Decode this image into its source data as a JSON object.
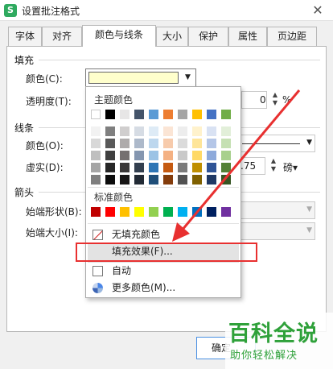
{
  "window": {
    "title": "设置批注格式",
    "app_logo": "S",
    "close": "✕"
  },
  "tabs": [
    {
      "label": "字体"
    },
    {
      "label": "对齐"
    },
    {
      "label": "颜色与线条"
    },
    {
      "label": "大小"
    },
    {
      "label": "保护"
    },
    {
      "label": "属性"
    },
    {
      "label": "页边距"
    }
  ],
  "fill": {
    "section": "填充",
    "color_label": "颜色(C):",
    "color_value": "#ffffcc",
    "transparency_label": "透明度(T):",
    "transparency_value": "0",
    "transparency_unit": "%"
  },
  "line": {
    "section": "线条",
    "color_label": "颜色(O):",
    "dash_label": "虚实(D):",
    "weight_value": ".75",
    "weight_unit": "磅▾"
  },
  "arrows": {
    "section": "箭头",
    "begin_style_label": "始端形状(B):",
    "begin_size_label": "始端大小(I):"
  },
  "color_popup": {
    "theme_heading": "主题颜色",
    "standard_heading": "标准颜色",
    "theme_top_row": [
      "#ffffff",
      "#000000",
      "#e7e6e6",
      "#44546a",
      "#5b9bd5",
      "#ed7d31",
      "#a5a5a5",
      "#ffc000",
      "#4472c4",
      "#70ad47"
    ],
    "theme_shades": [
      [
        "#f2f2f2",
        "#7f7f7f",
        "#d0cece",
        "#d6dce4",
        "#deebf6",
        "#fbe5d5",
        "#ededed",
        "#fff2cc",
        "#d9e2f3",
        "#e2efd9"
      ],
      [
        "#d8d8d8",
        "#595959",
        "#aeabab",
        "#adb9ca",
        "#bdd7ee",
        "#f7cbac",
        "#dbdbdb",
        "#fee599",
        "#b4c6e7",
        "#c5e0b3"
      ],
      [
        "#bfbfbf",
        "#3f3f3f",
        "#757070",
        "#8496b0",
        "#9cc3e5",
        "#f4b183",
        "#c9c9c9",
        "#ffd966",
        "#8eaadb",
        "#a8d08d"
      ],
      [
        "#a5a5a5",
        "#262626",
        "#3a3838",
        "#323f4f",
        "#2e75b5",
        "#c55a11",
        "#7b7b7b",
        "#bf8f00",
        "#2f5496",
        "#538135"
      ],
      [
        "#7f7f7f",
        "#0c0c0c",
        "#171616",
        "#222a35",
        "#1f4e79",
        "#843c0c",
        "#525252",
        "#7f6000",
        "#1f3864",
        "#375623"
      ]
    ],
    "standard_colors": [
      "#c00000",
      "#ff0000",
      "#ffc000",
      "#ffff00",
      "#92d050",
      "#00b050",
      "#00b0f0",
      "#0070c0",
      "#002060",
      "#7030a0"
    ],
    "no_fill": "无填充颜色",
    "fill_effects": "填充效果(F)...",
    "automatic": "自动",
    "more_colors": "更多颜色(M)..."
  },
  "buttons": {
    "ok": "确定"
  },
  "watermark": {
    "main": "百科全说",
    "sub": "助你轻松解决"
  },
  "colors": {
    "highlight": "#e83030",
    "watermark": "#2fa13a"
  }
}
